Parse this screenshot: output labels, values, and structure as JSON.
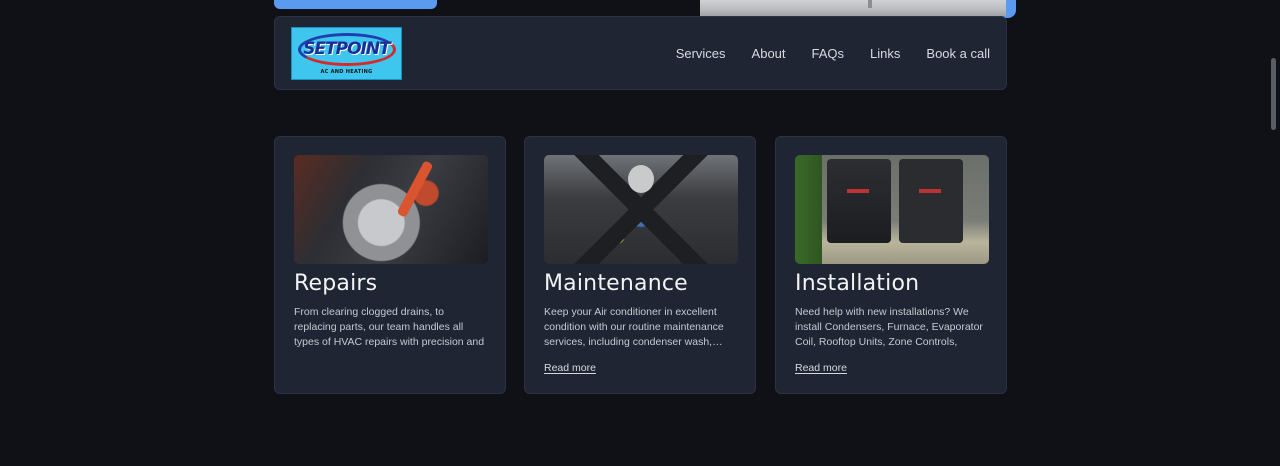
{
  "header": {
    "logo": {
      "brand": "SETPOINT",
      "tagline": "AC AND HEATING"
    },
    "nav": [
      "Services",
      "About",
      "FAQs",
      "Links",
      "Book a call"
    ]
  },
  "services": [
    {
      "title": "Repairs",
      "description": "From clearing clogged drains, to replacing parts, our team handles all types of HVAC repairs with precision and care.",
      "link": ""
    },
    {
      "title": "Maintenance",
      "description": "Keep your Air conditioner in excellent condition with our routine maintenance services, including condenser wash,…",
      "link": "Read more"
    },
    {
      "title": "Installation",
      "description": "Need help with new installations? We install Condensers, Furnace, Evaporator Coil, Rooftop Units, Zone Controls, Ductwork,…",
      "link": "Read more"
    }
  ],
  "colors": {
    "background": "#0f1117",
    "card": "#1f2533",
    "accent": "#5a9bf0"
  }
}
